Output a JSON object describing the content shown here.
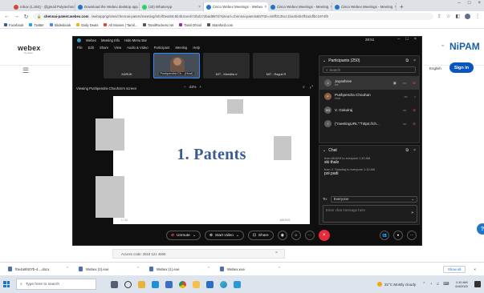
{
  "browser": {
    "tabs": [
      {
        "label": "Inbox (1,264) - @gmail Polytechnic",
        "color": "#d44638",
        "active": false
      },
      {
        "label": "Download the Webex desktop app",
        "color": "#1f76c9",
        "active": false
      },
      {
        "label": "(33) WhatsApp",
        "color": "#25d366",
        "active": false
      },
      {
        "label": "Cisco Webex Meetings - Webex",
        "color": "#1f76c9",
        "active": true
      },
      {
        "label": "Cisco Webex Meetings - Meeting",
        "color": "#1f76c9",
        "active": false
      },
      {
        "label": "Cisco Webex Meetings - Meeting",
        "color": "#1f76c9",
        "active": false
      }
    ],
    "new_tab": "+",
    "window_controls": [
      "–",
      "□",
      "×"
    ],
    "url_host": "chennai-patent.webex.com",
    "url_path": "/webappng/sites/chennai-patent/meeting/info/f0ea93c6b4b4ceeb72bd172bad987d?siteurl=chennai-patent&MTID=m9ff2135cc1ba4b4b4ff4a2dfbc1974f0",
    "bookmarks": [
      {
        "label": "Facebook",
        "color": "#3b5998"
      },
      {
        "label": "Twitter",
        "color": "#1da1f2"
      },
      {
        "label": "Slidesbook",
        "color": "#4285f4"
      },
      {
        "label": "Daily Deals",
        "color": "#f4b400"
      },
      {
        "label": "All Movies | Tamil...",
        "color": "#ea4335"
      },
      {
        "label": "TamilRockers.net",
        "color": "#555555"
      },
      {
        "label": "Tamil Dhool",
        "color": "#9c27b0"
      },
      {
        "label": "Stamford.com",
        "color": "#555555"
      }
    ]
  },
  "page": {
    "webex_logo": "webex",
    "webex_sub": "by cisco",
    "hamburger": "☰",
    "brand": "NiPAM",
    "language": "English",
    "signin_label": "Sign in",
    "under_banner": "Access code: 2518 121 4606",
    "under_close": "×",
    "feedback": "?"
  },
  "meeting": {
    "title_items": [
      "Webex",
      "Meeting Info",
      "Hide Menu Bar"
    ],
    "time": "28:51",
    "window_controls": [
      "–",
      "□",
      "×"
    ],
    "menu": [
      "File",
      "Edit",
      "Share",
      "View",
      "Audio & Video",
      "Participant",
      "Meeting",
      "Help"
    ],
    "thumbnails": [
      "KARUK",
      "Pushpendra Ch... (Host)",
      "MIT - Mandira d",
      "MIT - Raguk R"
    ],
    "viewing_label": "Viewing Pushpendra Chouhan's screen",
    "zoom_level": "41%",
    "zoom_minus": "–",
    "zoom_plus": "+",
    "slide": {
      "title": "1. Patents",
      "footer_left": "1 / 12",
      "footer_right": "6/4/2022"
    },
    "controls": {
      "unmute": "Unmute",
      "start_video": "Start video",
      "share": "Share",
      "end": "×"
    },
    "participants": {
      "header": "Participants (250)",
      "search_placeholder": "Search",
      "items": [
        {
          "initials": "J",
          "name": "Jayashree",
          "sub": "Me",
          "selected": true
        },
        {
          "initials": "P",
          "name": "Pushpendra Chouhan",
          "sub": "Host",
          "selected": false,
          "photo": true
        },
        {
          "initials": "VG",
          "name": "V. Gokulraj",
          "sub": "",
          "selected": false
        },
        {
          "initials": "?",
          "name": "{\"meetingURL\":\"https://ch...",
          "sub": "",
          "selected": false
        }
      ]
    },
    "chat": {
      "header": "Chat",
      "messages": [
        {
          "from": "from AKASH to everyone  1:10 AM",
          "text": "ski thalo"
        },
        {
          "from": "from V. Gokulraj to everyone  1:10 AM",
          "text": "poi padi"
        }
      ],
      "to_label": "To:",
      "to_value": "Everyone",
      "input_placeholder": "Enter chat message here"
    }
  },
  "downloads": {
    "items": [
      "f0e4a9f407b-4....docx",
      "Webex (2).exe",
      "Webex (1).exe",
      "Webex.exe"
    ],
    "show_all": "Show all",
    "close": "×"
  },
  "taskbar": {
    "search_placeholder": "Type here to search",
    "weather": "32°C Mostly cloudy",
    "time": "1:10 AM",
    "date": "6/4/2022"
  }
}
